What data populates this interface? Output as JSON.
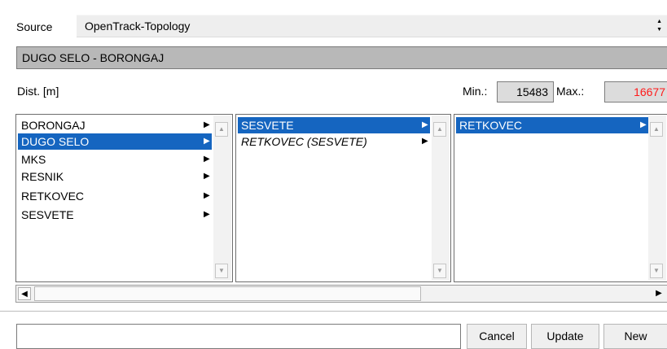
{
  "source": {
    "label": "Source",
    "selected": "OpenTrack-Topology",
    "arrow_up": "▲",
    "arrow_down": "▼"
  },
  "route": {
    "title": "DUGO SELO - BORONGAJ"
  },
  "distance": {
    "label": "Dist. [m]",
    "min_label": "Min.:",
    "min_value": "15483",
    "max_label": "Max.:",
    "max_value": "16677",
    "max_color": "#ff1a1a"
  },
  "lists": {
    "col1": [
      {
        "label": "BORONGAJ",
        "selected": false,
        "italic": false
      },
      {
        "label": "DUGO SELO",
        "selected": true,
        "italic": false
      },
      {
        "label": "MKS",
        "selected": false,
        "italic": false
      },
      {
        "label": "RESNIK",
        "selected": false,
        "italic": false
      },
      {
        "label": "RETKOVEC",
        "selected": false,
        "italic": false
      },
      {
        "label": "SESVETE",
        "selected": false,
        "italic": false
      }
    ],
    "col2": [
      {
        "label": "SESVETE",
        "selected": true,
        "italic": false
      },
      {
        "label": "RETKOVEC (SESVETE)",
        "selected": false,
        "italic": true
      }
    ],
    "col3": [
      {
        "label": "RETKOVEC",
        "selected": true,
        "italic": false
      }
    ],
    "chevron": "▶",
    "scroll_up": "▲",
    "scroll_down": "▼",
    "hscroll_left": "◀",
    "hscroll_right": "▶"
  },
  "footer": {
    "input_value": "",
    "cancel_label": "Cancel",
    "update_label": "Update",
    "new_label": "New"
  },
  "colors": {
    "selection": "#1565c0",
    "route_bar": "#b8b8b8",
    "readonly_field": "#dcdcdc"
  }
}
